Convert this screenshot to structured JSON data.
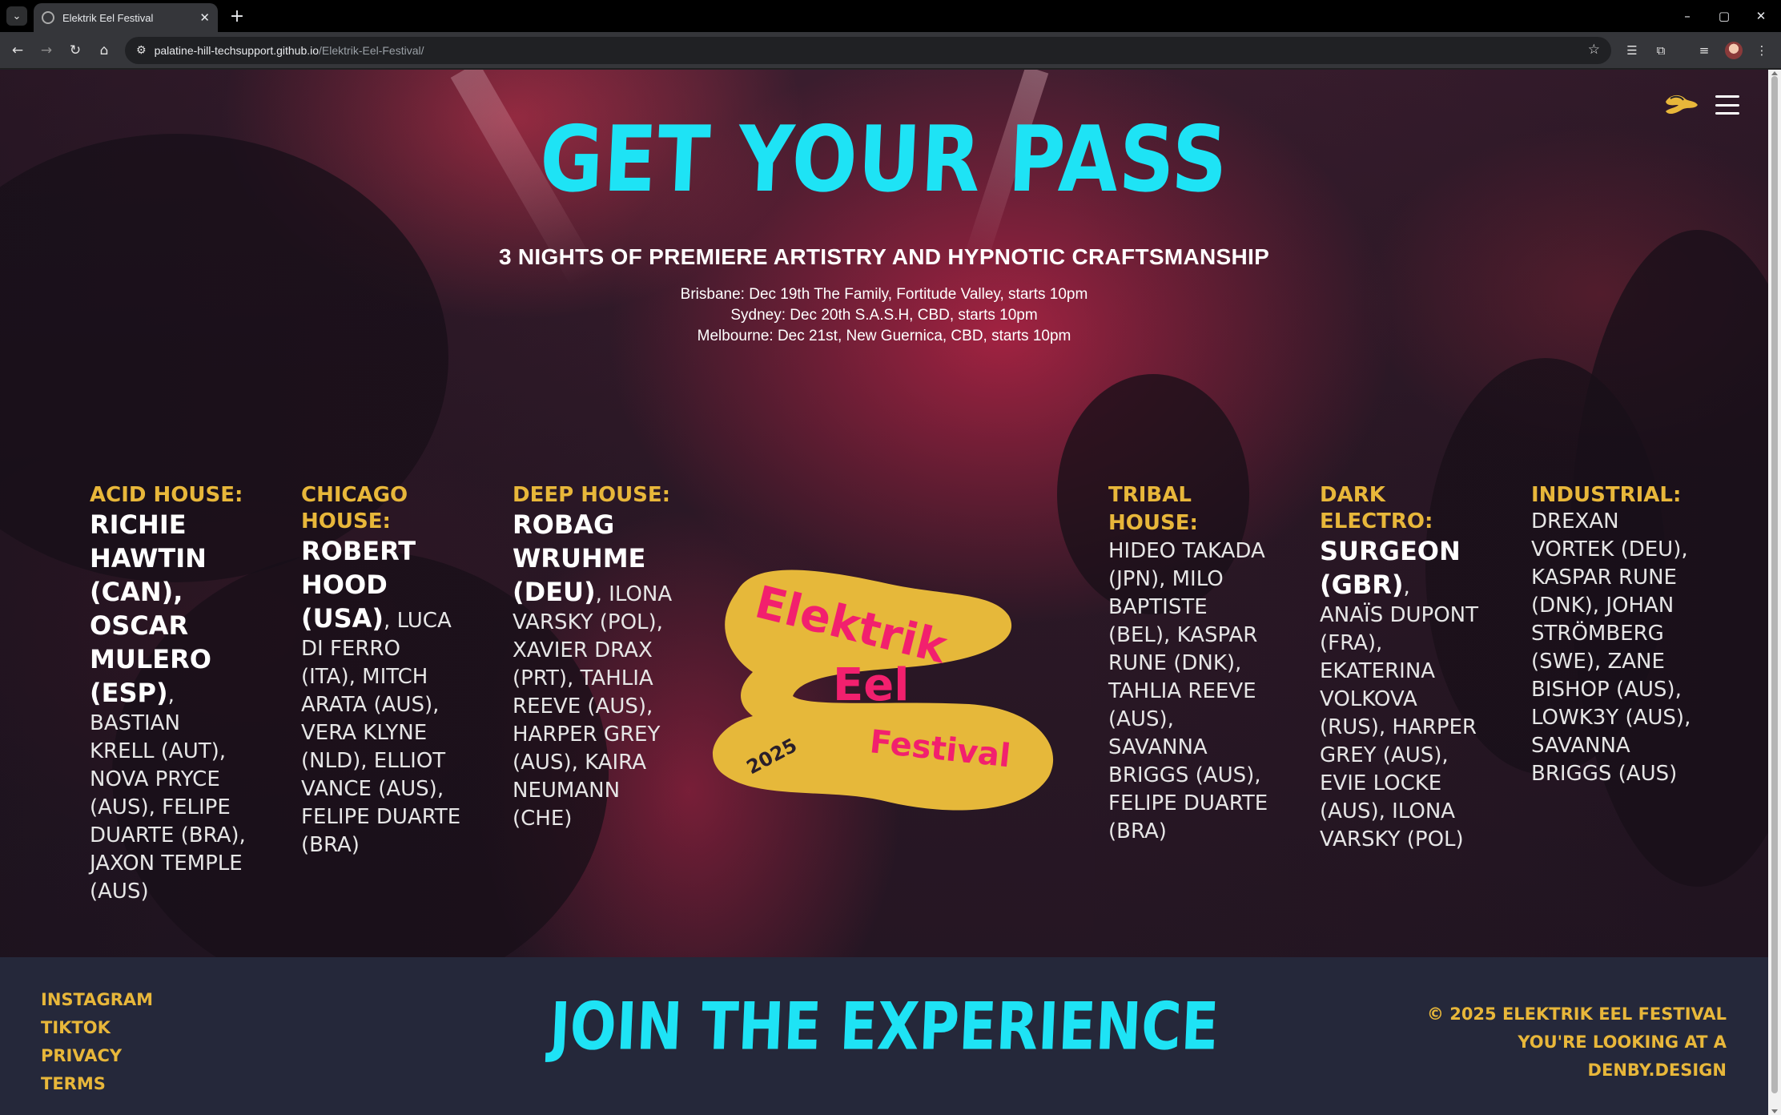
{
  "browser": {
    "tab_title": "Elektrik Eel Festival",
    "url_host": "palatine-hill-techsupport.github.io",
    "url_path": "/Elektrik-Eel-Festival/"
  },
  "page": {
    "headline": "Get your pass",
    "subheadline": "3 NIGHTS OF PREMIERE ARTISTRY AND HYPNOTIC CRAFTSMANSHIP",
    "dates": [
      "Brisbane: Dec 19th The Family, Fortitude Valley, starts 10pm",
      "Sydney: Dec 20th S.A.S.H, CBD, starts 10pm",
      "Melbourne: Dec 21st, New Guernica, CBD, starts 10pm"
    ],
    "lineup": [
      {
        "genre": "Acid House:",
        "headliners": "Richie Hawtin (CAN), Oscar Mulero (ESP)",
        "support": ", Bastian Krell (AUT), Nova Pryce (AUS), Felipe Duarte (BRA), Jaxon Temple (AUS)"
      },
      {
        "genre": "Chicago House:",
        "headliners": "Robert Hood (USA)",
        "support": ", Luca Di Ferro (ITA), Mitch Arata (AUS), Vera Klyne (NLD), Elliot Vance (AUS), Felipe Duarte (BRA)"
      },
      {
        "genre": "Deep House:",
        "headliners": "Robag Wruhme (DEU)",
        "support": ", Ilona Varsky (POL), Xavier Drax (PRT), Tahlia Reeve (AUS), Harper Grey (AUS), Kaira Neumann (CHE)"
      },
      {
        "genre": "Tribal House:",
        "headliners": "",
        "support": " Hideo Takada (JPN), Milo Baptiste (BEL), Kaspar Rune (DNK), Tahlia Reeve (AUS), Savanna Briggs (AUS), Felipe Duarte (BRA)"
      },
      {
        "genre": "Dark Electro:",
        "headliners": "Surgeon (GBR)",
        "support": ", Anaïs Dupont (FRA), Ekaterina Volkova (RUS), Harper Grey (AUS), Evie Locke (AUS), Ilona Varsky (POL)"
      },
      {
        "genre": "Industrial:",
        "headliners": "",
        "support": "Drexan Vortek (DEU), Kaspar Rune (DNK), Johan Strömberg (SWE), Zane Bishop (AUS), LOWK3Y (AUS), Savanna Briggs (AUS)"
      }
    ],
    "logo": {
      "line1": "Elektrik",
      "line2": "Eel",
      "line3": "Festival",
      "year": "2025"
    }
  },
  "footer": {
    "links": [
      "Instagram",
      "TikTok",
      "Privacy",
      "Terms"
    ],
    "cta": "Join the experience",
    "copyright": "© 2025 Elektrik Eel Festival",
    "credit_prefix": "You're looking at a",
    "credit_link": "denby.design"
  },
  "colors": {
    "accent_cyan": "#1ee3f5",
    "accent_gold": "#e8b73a",
    "accent_pink": "#f2206e",
    "footer_bg": "#25283a"
  }
}
